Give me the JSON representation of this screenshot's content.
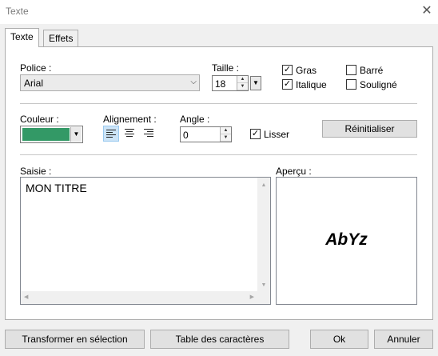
{
  "window": {
    "title": "Texte",
    "close_glyph": "✕"
  },
  "tabs": [
    {
      "label": "Texte",
      "active": true
    },
    {
      "label": "Effets",
      "active": false
    }
  ],
  "font": {
    "label": "Police :",
    "value": "Arial",
    "size_label": "Taille :",
    "size_value": "18"
  },
  "styles": {
    "bold": {
      "label": "Gras",
      "checked": true
    },
    "italic": {
      "label": "Italique",
      "checked": true
    },
    "strike": {
      "label": "Barré",
      "checked": false
    },
    "underline": {
      "label": "Souligné",
      "checked": false
    }
  },
  "color": {
    "label": "Couleur :",
    "swatch": "#339966"
  },
  "alignment": {
    "label": "Alignement :",
    "selected": "left"
  },
  "angle": {
    "label": "Angle :",
    "value": "0"
  },
  "smooth": {
    "label": "Lisser",
    "checked": true
  },
  "reset_button": "Réinitialiser",
  "input": {
    "label": "Saisie :",
    "value": "MON TITRE"
  },
  "preview": {
    "label": "Aperçu :",
    "sample": "AbYz"
  },
  "footer": {
    "transform_button": "Transformer en sélection",
    "charmap_button": "Table des caractères",
    "ok_button": "Ok",
    "cancel_button": "Annuler"
  },
  "icons": {
    "checkmark": "✓",
    "spin_up": "▲",
    "spin_down": "▼",
    "dropdown": "▼",
    "chevron": "⌵",
    "arrow_up": "▲",
    "arrow_down": "▼",
    "arrow_left": "◀",
    "arrow_right": "▶"
  }
}
